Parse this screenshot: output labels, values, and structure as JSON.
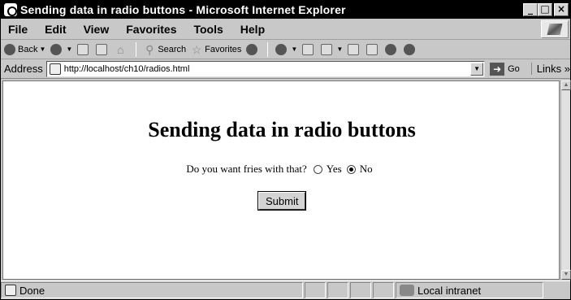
{
  "window": {
    "title": "Sending data in radio buttons - Microsoft Internet Explorer",
    "buttons": [
      "_",
      "□",
      "×"
    ]
  },
  "menu": {
    "items": [
      "File",
      "Edit",
      "View",
      "Favorites",
      "Tools",
      "Help"
    ]
  },
  "toolbar": {
    "back_label": "Back",
    "search_label": "Search",
    "favorites_label": "Favorites"
  },
  "address": {
    "label": "Address",
    "url": "http://localhost/ch10/radios.html",
    "go_label": "Go",
    "links_label": "Links »"
  },
  "page": {
    "heading": "Sending data in radio buttons",
    "question": "Do you want fries with that?",
    "options": [
      {
        "label": "Yes",
        "checked": false
      },
      {
        "label": "No",
        "checked": true
      }
    ],
    "submit_label": "Submit"
  },
  "status": {
    "text": "Done",
    "zone": "Local intranet"
  }
}
